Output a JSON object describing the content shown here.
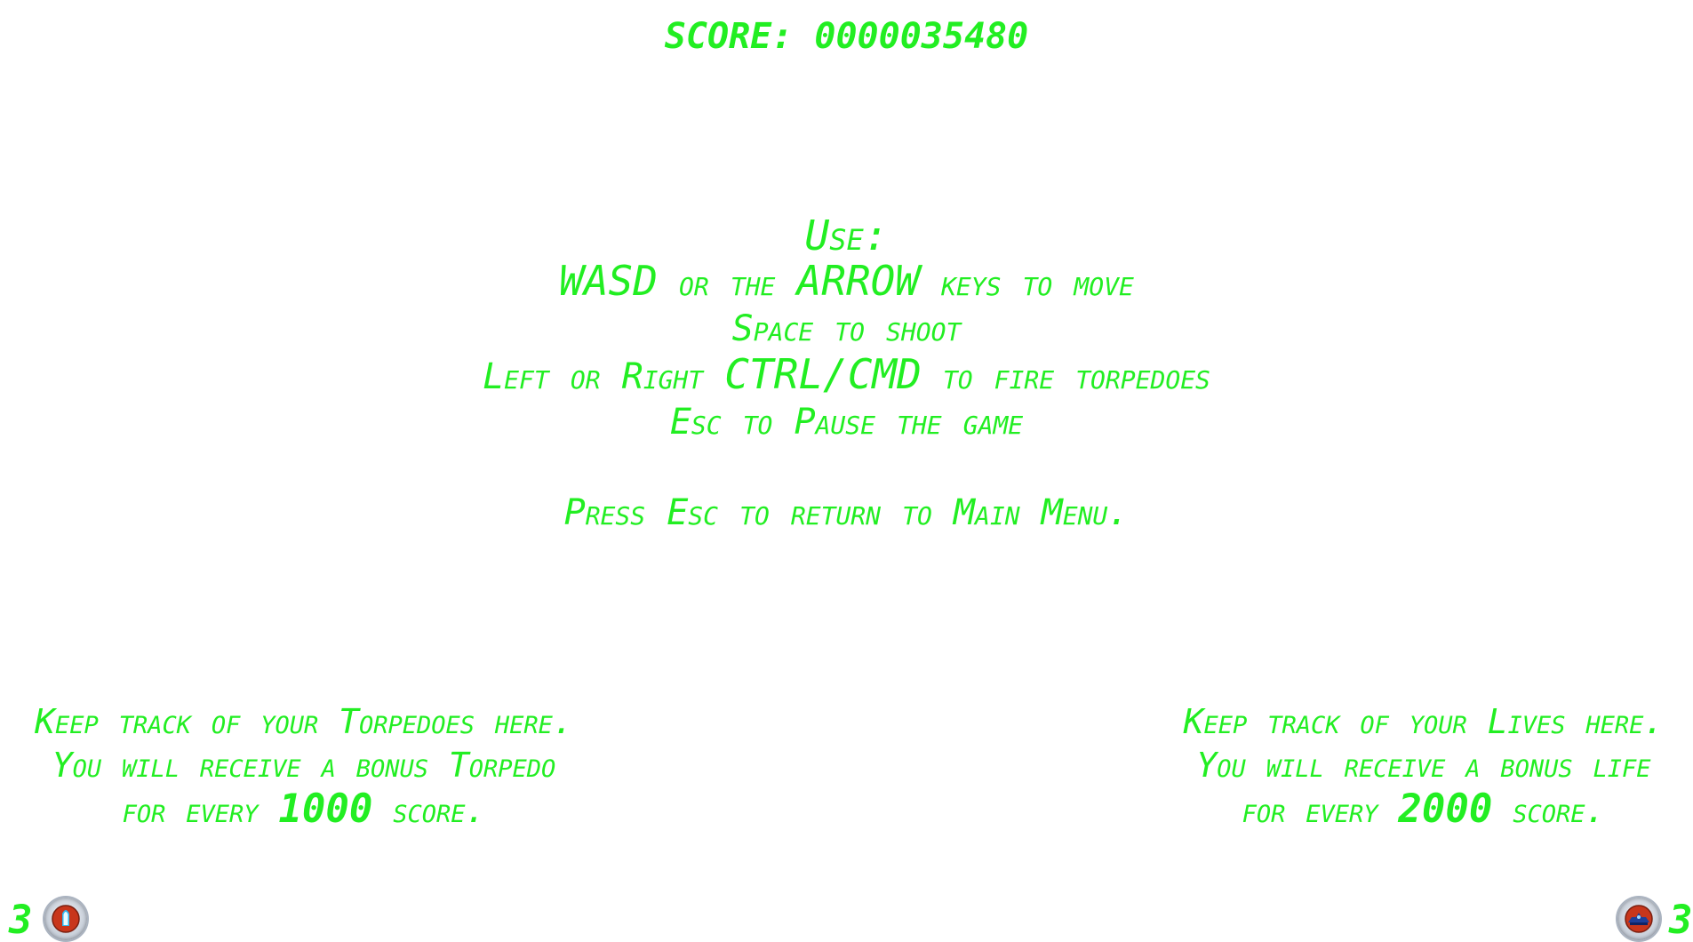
{
  "score": {
    "label": "SCORE:",
    "value": "0000035480"
  },
  "instructions": {
    "heading": "Use:",
    "move_a": "WASD",
    "move_b": " or the ",
    "move_c": "ARROW",
    "move_d": " keys to move",
    "shoot": "Space to shoot",
    "torp_a": "Left or Right ",
    "torp_b": "CTRL/CMD",
    "torp_c": " to fire torpedoes",
    "pause": "Esc to Pause the game",
    "return": "Press Esc to return to Main Menu."
  },
  "torpedo_tip": {
    "line1": "Keep track of your Torpedoes here.",
    "line2": "You will receive a bonus Torpedo",
    "line3_a": "for every ",
    "line3_num": "1000",
    "line3_b": " score."
  },
  "lives_tip": {
    "line1": "Keep track of your Lives here.",
    "line2": "You will receive a bonus life",
    "line3_a": "for every ",
    "line3_num": "2000",
    "line3_b": " score."
  },
  "hud": {
    "torpedo_count": "3",
    "torpedo_icon": "torpedo-icon",
    "lives_count": "3",
    "lives_icon": "ship-life-icon"
  },
  "colors": {
    "text": "#22ee22",
    "background": "#ffffff"
  }
}
